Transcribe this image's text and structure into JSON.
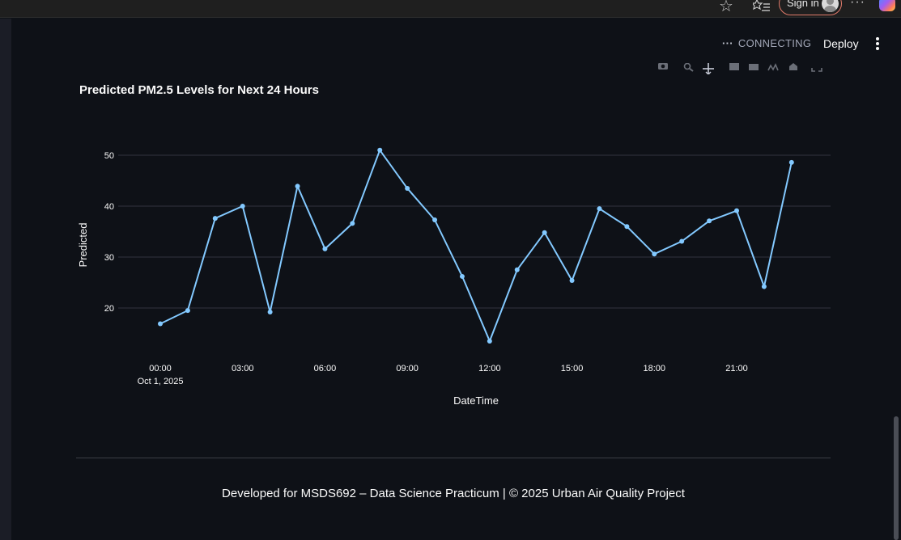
{
  "browser": {
    "sign_in_label": "Sign in",
    "menu_glyph": "···"
  },
  "header": {
    "status_label": "CONNECTING",
    "deploy_label": "Deploy"
  },
  "modebar": {
    "icons": [
      "camera-icon",
      "zoom-icon",
      "pan-icon",
      "box-select-icon",
      "lasso-icon",
      "zoom-in-icon",
      "zoom-out-icon",
      "autoscale-icon",
      "reset-axes-icon",
      "fullscreen-icon"
    ]
  },
  "colors": {
    "background": "#0e1117",
    "line": "#83c9ff",
    "grid": "#31333f",
    "text": "#fafafa"
  },
  "chart_data": {
    "type": "line",
    "title": "Predicted PM2.5 Levels for Next 24 Hours",
    "xlabel": "DateTime",
    "ylabel": "Predicted",
    "x": [
      "00:00",
      "01:00",
      "02:00",
      "03:00",
      "04:00",
      "05:00",
      "06:00",
      "07:00",
      "08:00",
      "09:00",
      "10:00",
      "11:00",
      "12:00",
      "13:00",
      "14:00",
      "15:00",
      "16:00",
      "17:00",
      "18:00",
      "19:00",
      "20:00",
      "21:00",
      "22:00",
      "23:00"
    ],
    "x_ticks": [
      "00:00",
      "03:00",
      "06:00",
      "09:00",
      "12:00",
      "15:00",
      "18:00",
      "21:00"
    ],
    "x_date_label": "Oct 1, 2025",
    "y_ticks": [
      20,
      30,
      40,
      50
    ],
    "ylim": [
      11,
      53
    ],
    "grid": true,
    "series": [
      {
        "values": [
          16.9,
          19.5,
          37.6,
          40.0,
          19.2,
          43.9,
          31.6,
          36.6,
          51.0,
          43.5,
          37.3,
          26.2,
          13.5,
          27.5,
          34.8,
          25.4,
          39.5,
          36.0,
          30.6,
          33.1,
          37.1,
          39.1,
          24.2,
          48.6
        ]
      }
    ]
  },
  "footer": {
    "text": "Developed for MSDS692 – Data Science Practicum | © 2025 Urban Air Quality Project"
  }
}
